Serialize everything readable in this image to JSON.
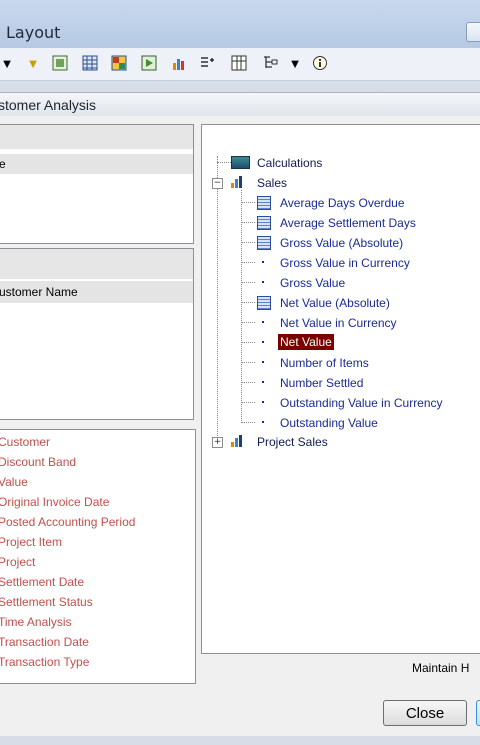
{
  "window": {
    "title": "Layout"
  },
  "toolbar": {
    "icons": [
      "dropdown-arrow-icon",
      "filter-icon",
      "layout-icon",
      "table-icon",
      "color-table-icon",
      "play-table-icon",
      "bar-chart-icon",
      "outline-icon",
      "columns-icon",
      "tree-icon",
      "dropdown-arrow-icon",
      "info-icon"
    ]
  },
  "header": {
    "title": "stomer Analysis"
  },
  "left": {
    "panel1_selected": "e",
    "panel2_selected": "ustomer Name",
    "fields": [
      "Customer",
      "Discount Band",
      "Value",
      "Original Invoice Date",
      "Posted Accounting Period",
      "Project Item",
      "Project",
      "Settlement Date",
      "Settlement Status",
      "Time Analysis",
      "Transaction Date",
      "Transaction Type"
    ]
  },
  "tree": {
    "calculations": "Calculations",
    "sales": "Sales",
    "sales_items": [
      {
        "label": "Average Days Overdue",
        "icon": "grid"
      },
      {
        "label": "Average Settlement Days",
        "icon": "grid"
      },
      {
        "label": "Gross Value (Absolute)",
        "icon": "grid"
      },
      {
        "label": "Gross Value in Currency",
        "icon": "dot"
      },
      {
        "label": "Gross Value",
        "icon": "dot"
      },
      {
        "label": "Net Value (Absolute)",
        "icon": "grid"
      },
      {
        "label": "Net Value in Currency",
        "icon": "dot"
      },
      {
        "label": "Net Value",
        "icon": "dot",
        "selected": true
      },
      {
        "label": "Number of Items",
        "icon": "dot"
      },
      {
        "label": "Number Settled",
        "icon": "dot"
      },
      {
        "label": "Outstanding Value in Currency",
        "icon": "dot"
      },
      {
        "label": "Outstanding Value",
        "icon": "dot"
      }
    ],
    "project_sales": "Project Sales"
  },
  "footer": {
    "maintain": "Maintain H",
    "close": "Close"
  },
  "colors": {
    "selection": "#7a0000",
    "field_text": "#c0504d",
    "tree_text": "#1a2a96"
  }
}
